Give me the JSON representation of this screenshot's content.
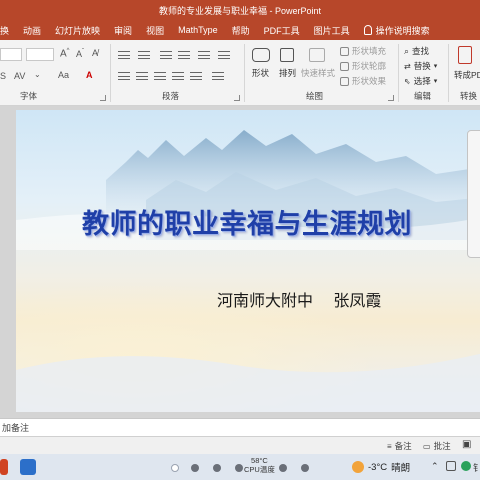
{
  "window": {
    "title": "教师的专业发展与职业幸福 - PowerPoint"
  },
  "menu": {
    "tabs": [
      "换",
      "动画",
      "幻灯片放映",
      "审阅",
      "视图",
      "MathType",
      "帮助",
      "PDF工具",
      "图片工具"
    ],
    "search_label": "操作说明搜索"
  },
  "ribbon": {
    "groups": {
      "font": "字体",
      "paragraph": "段落",
      "drawing": "绘图",
      "editing": "编辑",
      "convert": "转换"
    },
    "drawing": {
      "shape": "形状",
      "arrange": "排列",
      "quick_styles": "快速样式",
      "shape_fill": "形状填充",
      "shape_outline": "形状轮廓",
      "shape_effects": "形状效果"
    },
    "editing": {
      "find": "查找",
      "replace": "替换",
      "select": "选择"
    },
    "convert": {
      "to_pdf": "转成PDF"
    }
  },
  "slide": {
    "title": "教师的职业幸福与生涯规划",
    "subtitle": "河南师大附中    张凤霞"
  },
  "notes": {
    "placeholder": "加备注"
  },
  "status": {
    "notes_btn": "备注",
    "comments_btn": "批注"
  },
  "taskbar": {
    "cpu_temp": "58°C",
    "cpu_label": "CPU温度",
    "weather_temp": "-3°C",
    "weather_desc": "晴朗",
    "tray_text": "钅"
  },
  "colors": {
    "accent": "#b7472a",
    "title_blue": "#1f3fa8"
  }
}
